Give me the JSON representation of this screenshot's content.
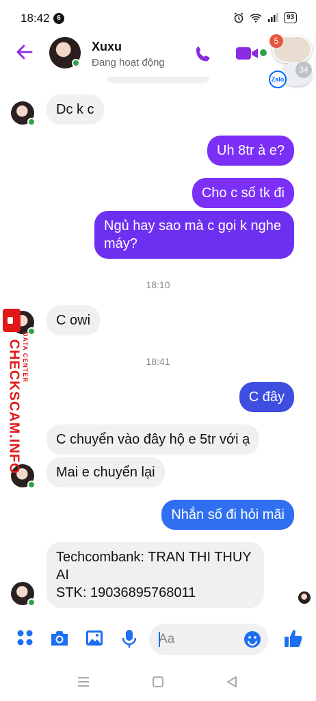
{
  "status_bar": {
    "time": "18:42",
    "notification_count": "6",
    "battery": "93"
  },
  "header": {
    "contact_name": "Xuxu",
    "contact_status": "Đang hoạt động",
    "chat_head_badge": "5",
    "zalo_label": "Zalo",
    "secondary_badge": "34"
  },
  "messages": [
    {
      "side": "in",
      "text": "Dc k c"
    },
    {
      "side": "out",
      "text": "Uh 8tr à e?"
    },
    {
      "side": "out",
      "text": "Cho c số tk đi"
    },
    {
      "side": "out",
      "text": "Ngủ hay sao mà c gọi k nghe máy?"
    },
    {
      "side": "in",
      "text": "C owi"
    },
    {
      "side": "out",
      "text": "C đây"
    },
    {
      "side": "in",
      "text": "C chuyển vào đây hộ e 5tr với ạ"
    },
    {
      "side": "in",
      "text": "Mai e chuyển lại"
    },
    {
      "side": "out",
      "text": "Nhắn số đi hỏi mãi"
    },
    {
      "side": "in",
      "text": "Techcombank: TRAN THI THUY AI\nSTK: 19036895768011"
    }
  ],
  "timestamps": [
    "18:10",
    "18:41"
  ],
  "composer": {
    "placeholder": "Aa"
  },
  "watermark": {
    "main": "CHECKSCAM.INFO",
    "sub": "DATA CENTER"
  },
  "colors": {
    "accent_purple": "#7b2ff7",
    "accent_blue": "#1e6ff0",
    "online_green": "#31a24c"
  }
}
